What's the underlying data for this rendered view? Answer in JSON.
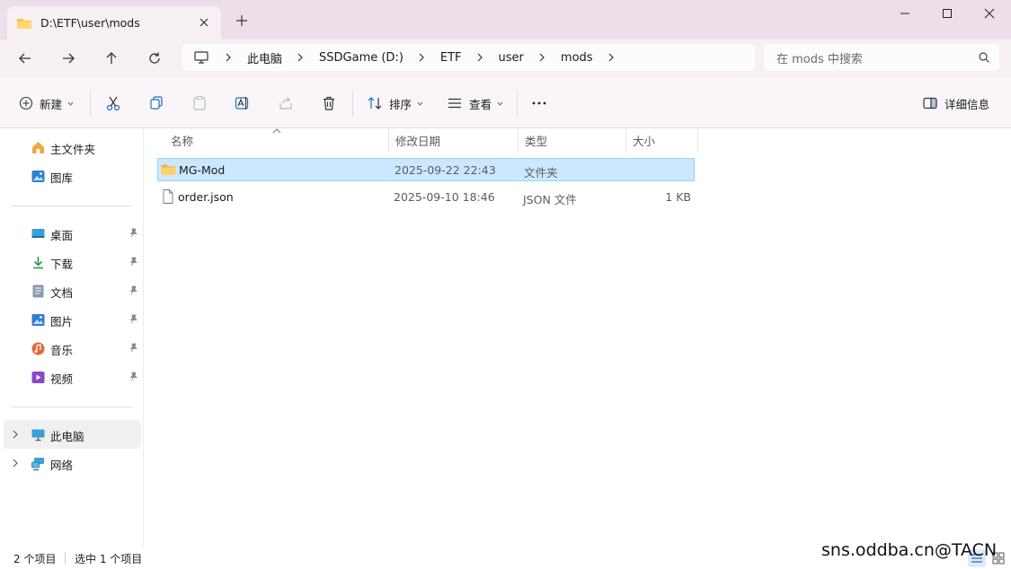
{
  "window": {
    "tab_title": "D:\\ETF\\user\\mods"
  },
  "address": {
    "breadcrumbs": [
      "此电脑",
      "SSDGame (D:)",
      "ETF",
      "user",
      "mods"
    ],
    "search_placeholder": "在 mods 中搜索"
  },
  "toolbar": {
    "new_label": "新建",
    "sort_label": "排序",
    "view_label": "查看",
    "details_label": "详细信息"
  },
  "sidebar": {
    "items": [
      {
        "label": "主文件夹",
        "icon": "home-icon"
      },
      {
        "label": "图库",
        "icon": "gallery-icon"
      },
      {
        "label": "桌面",
        "icon": "desktop-icon",
        "pinned": true
      },
      {
        "label": "下载",
        "icon": "download-icon",
        "pinned": true
      },
      {
        "label": "文档",
        "icon": "document-icon",
        "pinned": true
      },
      {
        "label": "图片",
        "icon": "pictures-icon",
        "pinned": true
      },
      {
        "label": "音乐",
        "icon": "music-icon",
        "pinned": true
      },
      {
        "label": "视频",
        "icon": "video-icon",
        "pinned": true
      },
      {
        "label": "此电脑",
        "icon": "this-pc-icon",
        "expandable": true
      },
      {
        "label": "网络",
        "icon": "network-icon",
        "expandable": true
      }
    ]
  },
  "file_list": {
    "columns": [
      "名称",
      "修改日期",
      "类型",
      "大小"
    ],
    "rows": [
      {
        "name": "MG-Mod",
        "modified": "2025-09-22 22:43",
        "type": "文件夹",
        "size": "",
        "icon": "folder-icon",
        "selected": true
      },
      {
        "name": "order.json",
        "modified": "2025-09-10 18:46",
        "type": "JSON 文件",
        "size": "1 KB",
        "icon": "file-icon",
        "selected": false
      }
    ]
  },
  "status": {
    "item_count": "2 个项目",
    "selected_count": "选中 1 个项目"
  },
  "watermark": "sns.oddba.cn@TACN",
  "colors": {
    "accent": "#0067c0",
    "selection": "#cce8ff",
    "titlebar": "#ecdfe9",
    "folder": "#f8c44f"
  }
}
